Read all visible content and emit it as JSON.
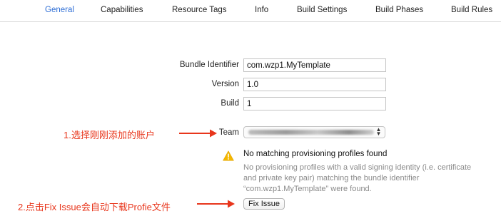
{
  "tabs": [
    {
      "label": "General",
      "active": true
    },
    {
      "label": "Capabilities"
    },
    {
      "label": "Resource Tags"
    },
    {
      "label": "Info"
    },
    {
      "label": "Build Settings"
    },
    {
      "label": "Build Phases"
    },
    {
      "label": "Build Rules"
    }
  ],
  "form": {
    "bundle_identifier_label": "Bundle Identifier",
    "bundle_identifier_value": "com.wzp1.MyTemplate",
    "version_label": "Version",
    "version_value": "1.0",
    "build_label": "Build",
    "build_value": "1",
    "team_label": "Team"
  },
  "warning": {
    "title": "No matching provisioning profiles found",
    "body": "No provisioning profiles with a valid signing identity (i.e. certificate and private key pair) matching the bundle identifier “com.wzp1.MyTemplate” were found.",
    "icon": "warning-triangle-icon",
    "icon_color": "#f5b800"
  },
  "fix_issue_label": "Fix Issue",
  "annotations": {
    "step1": "1.选择刚刚添加的账户",
    "step2": "2.点击Fix Issue会自动下载Profie文件",
    "color": "#e8361c"
  },
  "colors": {
    "active_tab": "#2f6fd6"
  }
}
